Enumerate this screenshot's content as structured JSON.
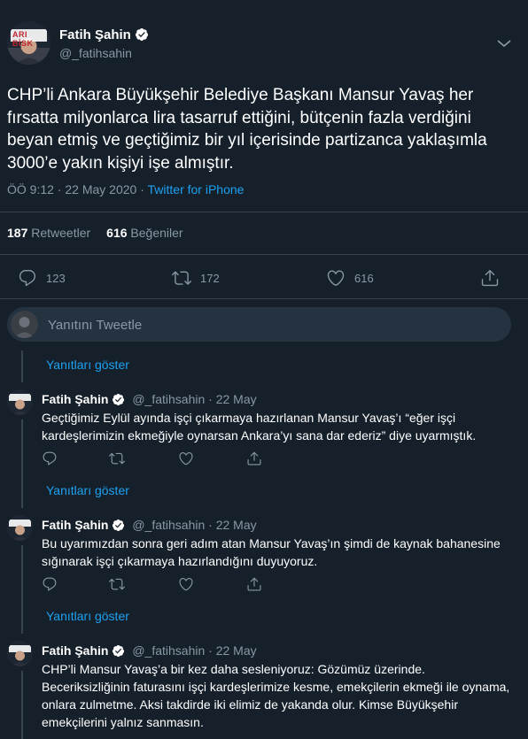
{
  "main_tweet": {
    "author_name": "Fatih Şahin",
    "author_handle": "@_fatihsahin",
    "avatar_text": "ARI BİSK",
    "text": "CHP’li Ankara Büyükşehir Belediye Başkanı Mansur Yavaş her fırsatta milyonlarca lira tasarruf ettiğini, bütçenin fazla verdiğini beyan etmiş ve geçtiğimiz bir yıl içerisinde partizanca yaklaşımla 3000’e yakın kişiyi işe almıştır.",
    "time": "ÖÖ 9:12 · 22 May 2020 · ",
    "source": "Twitter for iPhone",
    "retweets": "187",
    "retweets_label": "Retweetler",
    "likes": "616",
    "likes_label": "Beğeniler",
    "reply_count": "123",
    "retweet_count": "172",
    "like_count": "616"
  },
  "reply_box": {
    "placeholder": "Yanıtını Tweetle"
  },
  "show_replies_label": "Yanıtları göster",
  "replies": [
    {
      "name": "Fatih Şahin",
      "handle": "@_fatihsahin · 22 May",
      "text": "Geçtiğimiz Eylül ayında işçi çıkarmaya hazırlanan Mansur Yavaş’ı “eğer işçi kardeşlerimizin ekmeğiyle oynarsan Ankara’yı sana dar ederiz” diye uyarmıştık."
    },
    {
      "name": "Fatih Şahin",
      "handle": "@_fatihsahin · 22 May",
      "text": "Bu uyarımızdan sonra geri adım atan Mansur Yavaş’ın şimdi de kaynak bahanesine sığınarak işçi çıkarmaya hazırlandığını duyuyoruz."
    },
    {
      "name": "Fatih Şahin",
      "handle": "@_fatihsahin · 22 May",
      "text": "CHP’li Mansur Yavaş’a bir kez daha sesleniyoruz: Gözümüz üzerinde. Beceriksizliğinin faturasını işçi kardeşlerimize kesme, emekçilerin ekmeği ile oynama, onlara zulmetme. Aksi takdirde iki elimiz de yakanda olur. Kimse Büyükşehir emekçilerini yalnız sanmasın."
    }
  ],
  "colors": {
    "background": "#15202b",
    "accent": "#1da1f2",
    "muted": "#8899a6",
    "border": "#38444d"
  }
}
